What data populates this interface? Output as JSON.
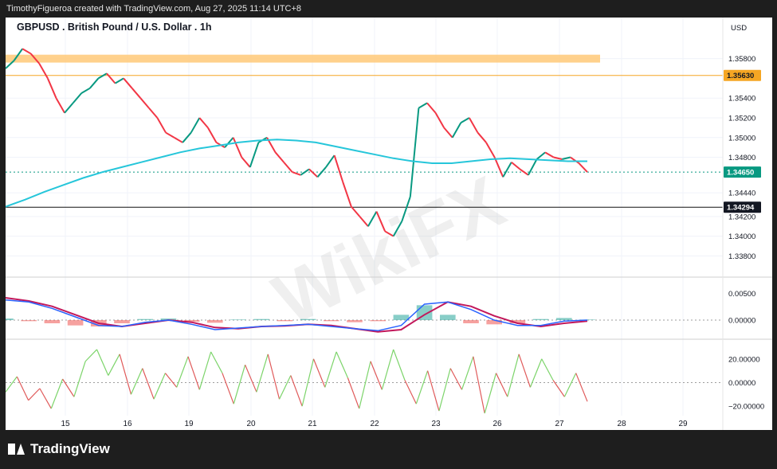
{
  "header": {
    "credit": "TimothyFigueroa created with TradingView.com, Aug 27, 2025 11:14 UTC+8"
  },
  "footer": {
    "brand": "TradingView"
  },
  "watermark": {
    "text": "WikiFX"
  },
  "chart_data": {
    "type": "line",
    "title": "GBPUSD . British Pound / U.S. Dollar . 1h",
    "currency": "USD",
    "grid": true,
    "x_ticks": [
      "15",
      "16",
      "19",
      "20",
      "21",
      "22",
      "23",
      "26",
      "27",
      "28",
      "29"
    ],
    "price_panel": {
      "ylim": [
        1.3365,
        1.3612
      ],
      "y_ticks": [
        "1.35800",
        "1.35400",
        "1.35200",
        "1.35000",
        "1.34800",
        "1.34440",
        "1.34200",
        "1.34000",
        "1.33800"
      ],
      "last_price": "1.34650",
      "resistance_level": "1.35630",
      "support_level": "1.34294",
      "resistance_zone": [
        1.3576,
        1.3584
      ],
      "price_series": {
        "name": "GBPUSD",
        "type": "candlestick-line",
        "color_up": "#089981",
        "color_down": "#f23645",
        "values": [
          1.357,
          1.3578,
          1.359,
          1.3585,
          1.3575,
          1.356,
          1.354,
          1.3525,
          1.3535,
          1.3545,
          1.355,
          1.356,
          1.3565,
          1.3555,
          1.356,
          1.355,
          1.354,
          1.353,
          1.352,
          1.3505,
          1.35,
          1.3495,
          1.3505,
          1.352,
          1.351,
          1.3495,
          1.349,
          1.35,
          1.348,
          1.347,
          1.3495,
          1.35,
          1.3485,
          1.3475,
          1.3465,
          1.3462,
          1.3468,
          1.346,
          1.347,
          1.3482,
          1.3455,
          1.343,
          1.342,
          1.341,
          1.3425,
          1.3405,
          1.34,
          1.3415,
          1.344,
          1.353,
          1.3535,
          1.3525,
          1.351,
          1.35,
          1.3515,
          1.352,
          1.3505,
          1.3495,
          1.348,
          1.346,
          1.3475,
          1.3468,
          1.3462,
          1.3478,
          1.3485,
          1.348,
          1.3478,
          1.348,
          1.3474,
          1.3465
        ]
      },
      "ma_series": {
        "name": "Moving Average",
        "color": "#26c6da",
        "values": [
          1.343,
          1.3437,
          1.3445,
          1.3452,
          1.3459,
          1.3465,
          1.347,
          1.3475,
          1.348,
          1.3485,
          1.3489,
          1.3492,
          1.3495,
          1.3497,
          1.3498,
          1.3497,
          1.3495,
          1.3491,
          1.3487,
          1.3483,
          1.3479,
          1.3476,
          1.3474,
          1.3474,
          1.3476,
          1.3478,
          1.3479,
          1.3478,
          1.3477,
          1.3476,
          1.3476
        ]
      }
    },
    "macd_panel": {
      "ylim": [
        -0.003,
        0.0075
      ],
      "y_ticks": [
        "0.00500",
        "0.00000"
      ],
      "macd_line": {
        "color": "#2962ff",
        "values": [
          0.0038,
          0.0034,
          0.0022,
          0.0006,
          -0.001,
          -0.0012,
          -0.0004,
          0.0,
          -0.0008,
          -0.0018,
          -0.0015,
          -0.0012,
          -0.001,
          -0.0008,
          -0.0012,
          -0.0016,
          -0.002,
          -0.001,
          0.003,
          0.0034,
          0.002,
          0.0,
          -0.001,
          -0.001,
          -0.0002,
          0.0
        ]
      },
      "signal_line": {
        "color": "#c2185b",
        "values": [
          0.0042,
          0.0036,
          0.0026,
          0.001,
          -0.0006,
          -0.0012,
          -0.0006,
          0.0,
          -0.0004,
          -0.0014,
          -0.0016,
          -0.0012,
          -0.0011,
          -0.0008,
          -0.001,
          -0.0016,
          -0.0022,
          -0.0018,
          0.001,
          0.0034,
          0.0026,
          0.0008,
          -0.0006,
          -0.0012,
          -0.0006,
          -0.0002
        ]
      },
      "histogram": {
        "color_pos": "#26a69a",
        "color_neg": "#ef5350",
        "values": [
          0.0003,
          -0.0002,
          -0.0006,
          -0.001,
          -0.0012,
          -0.0006,
          0.0002,
          0.0003,
          -0.0003,
          -0.0005,
          0.0001,
          0.0002,
          -0.0002,
          0.0002,
          -0.0002,
          -0.0004,
          -0.0002,
          0.001,
          0.0028,
          0.001,
          -0.0006,
          -0.0008,
          -0.0006,
          0.0002,
          0.0004,
          0.0001
        ]
      }
    },
    "oscillator_panel": {
      "ylim": [
        -28,
        34
      ],
      "y_ticks": [
        "20.00000",
        "0.00000",
        "−20.00000"
      ],
      "values": [
        -8,
        5,
        -15,
        -5,
        -22,
        3,
        -12,
        18,
        28,
        6,
        24,
        -10,
        12,
        -14,
        8,
        -4,
        22,
        -6,
        26,
        8,
        -18,
        15,
        -8,
        24,
        -14,
        6,
        -20,
        20,
        -4,
        26,
        4,
        -22,
        18,
        -6,
        28,
        2,
        -18,
        10,
        -24,
        12,
        -6,
        22,
        -26,
        8,
        -12,
        24,
        -4,
        20,
        2,
        -12,
        8,
        -16
      ],
      "color_pos": "#7cd46a",
      "color_neg": "#e05a5a"
    }
  }
}
